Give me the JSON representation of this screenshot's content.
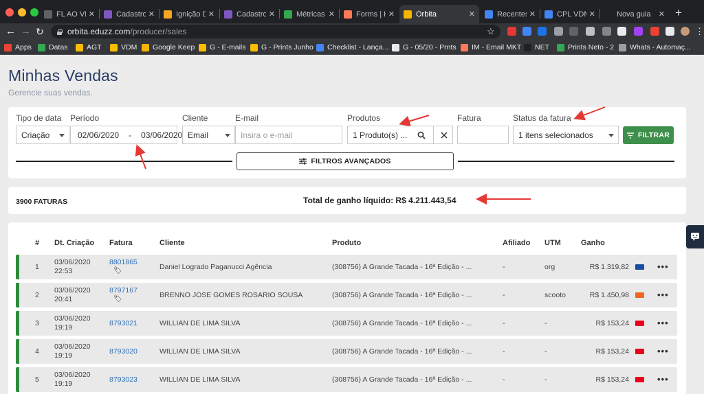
{
  "browser": {
    "tabs": [
      {
        "label": "FL AO VIVO",
        "icon_color": "#5f6368",
        "icon": "globe-icon"
      },
      {
        "label": "Cadastro p",
        "icon_color": "#7e57c2",
        "icon": "form-icon"
      },
      {
        "label": "Ignição Dig",
        "icon_color": "#f5a623",
        "icon": "bolt-icon"
      },
      {
        "label": "Cadastro p",
        "icon_color": "#7e57c2",
        "icon": "form-icon"
      },
      {
        "label": "Métricas Vi",
        "icon_color": "#34a853",
        "icon": "sheets-icon"
      },
      {
        "label": "Forms | Hu",
        "icon_color": "#ff7a59",
        "icon": "hubspot-icon"
      },
      {
        "label": "Órbita",
        "icon_color": "#f6b500",
        "icon": "orbita-icon",
        "active": true
      },
      {
        "label": "Recentes",
        "icon_color": "#4285f4",
        "icon": "drive-icon"
      },
      {
        "label": "CPL VDMR",
        "icon_color": "#4285f4",
        "icon": "drive-icon"
      },
      {
        "label": "Nova guia",
        "icon_color": "#202124",
        "icon": "blank-icon"
      }
    ],
    "url_host": "orbita.eduzz.com",
    "url_path": "/producer/sales",
    "bookmarks": [
      {
        "label": "Apps",
        "color": "#ea4335"
      },
      {
        "label": "Datas",
        "color": "#34a853"
      },
      {
        "label": "AGT",
        "color": "#fbbc04"
      },
      {
        "label": "VDM",
        "color": "#fbbc04"
      },
      {
        "label": "Google Keep",
        "color": "#f6b500"
      },
      {
        "label": "G - E-mails",
        "color": "#fbbc04"
      },
      {
        "label": "G - Prints Junho",
        "color": "#fbbc04"
      },
      {
        "label": "Checklist - Lança...",
        "color": "#4285f4"
      },
      {
        "label": "G - 05/20 - Prnts",
        "color": "#e8eaed"
      },
      {
        "label": "IM - Email MKT",
        "color": "#ff7a59"
      },
      {
        "label": "NET",
        "color": "#202124"
      },
      {
        "label": "Prints Neto - 2",
        "color": "#34a853"
      },
      {
        "label": "Whats - Automaç...",
        "color": "#9e9e9e"
      }
    ]
  },
  "page": {
    "title": "Minhas Vendas",
    "subtitle": "Gerencie suas vendas."
  },
  "filters": {
    "tipo_label": "Tipo de data",
    "tipo_value": "Criação",
    "periodo_label": "Período",
    "date_from": "02/06/2020",
    "date_sep": "-",
    "date_to": "03/06/2020",
    "cliente_label": "Cliente",
    "cliente_value": "Email",
    "email_label": "E-mail",
    "email_placeholder": "Insira o e-mail",
    "produtos_label": "Produtos",
    "produtos_value": "1 Produto(s) ...",
    "fatura_label": "Fatura",
    "fatura_value": "",
    "status_label": "Status da fatura",
    "status_value": "1 itens selecionados",
    "filtrar_label": "FILTRAR",
    "advanced_label": "FILTROS AVANÇADOS"
  },
  "summary": {
    "count": "3900 FATURAS",
    "total": "Total de ganho líquido: R$ 4.211.443,54"
  },
  "table": {
    "headers": [
      "#",
      "Dt. Criação",
      "Fatura",
      "Cliente",
      "Produto",
      "Afiliado",
      "UTM",
      "Ganho"
    ],
    "rows": [
      {
        "n": "1",
        "date": "03/06/2020",
        "time": "22:53",
        "fatura": "8801865",
        "tag": true,
        "cliente": "Daniel Logrado Paganucci Agência",
        "produto": "(308756) A Grande Tacada - 16ª Edição - ...",
        "afiliado": "-",
        "utm": "org",
        "ganho": "R$ 1.319,82",
        "payment": "visa"
      },
      {
        "n": "2",
        "date": "03/06/2020",
        "time": "20:41",
        "fatura": "8797167",
        "tag": true,
        "cliente": "BRENNO JOSE GOMES ROSARIO SOUSA",
        "produto": "(308756) A Grande Tacada - 16ª Edição - ...",
        "afiliado": "-",
        "utm": "scooto",
        "ganho": "R$ 1.450,98",
        "payment": "orange"
      },
      {
        "n": "3",
        "date": "03/06/2020",
        "time": "19:19",
        "fatura": "8793021",
        "tag": false,
        "cliente": "WILLIAN DE LIMA SILVA",
        "produto": "(308756) A Grande Tacada - 16ª Edição - ...",
        "afiliado": "-",
        "utm": "-",
        "ganho": "R$ 153,24",
        "payment": "mastercard"
      },
      {
        "n": "4",
        "date": "03/06/2020",
        "time": "19:19",
        "fatura": "8793020",
        "tag": false,
        "cliente": "WILLIAN DE LIMA SILVA",
        "produto": "(308756) A Grande Tacada - 16ª Edição - ...",
        "afiliado": "-",
        "utm": "-",
        "ganho": "R$ 153,24",
        "payment": "mastercard"
      },
      {
        "n": "5",
        "date": "03/06/2020",
        "time": "19:19",
        "fatura": "8793023",
        "tag": false,
        "cliente": "WILLIAN DE LIMA SILVA",
        "produto": "(308756) A Grande Tacada - 16ª Edição - ...",
        "afiliado": "-",
        "utm": "-",
        "ganho": "R$ 153,24",
        "payment": "mastercard"
      }
    ],
    "more_label": "•••"
  },
  "colors": {
    "accent_green": "#2e8b3d",
    "button_green": "#3f8f4c",
    "link_blue": "#2e6fb6",
    "title_blue": "#2a3f66",
    "annotation_red": "#e53935"
  }
}
